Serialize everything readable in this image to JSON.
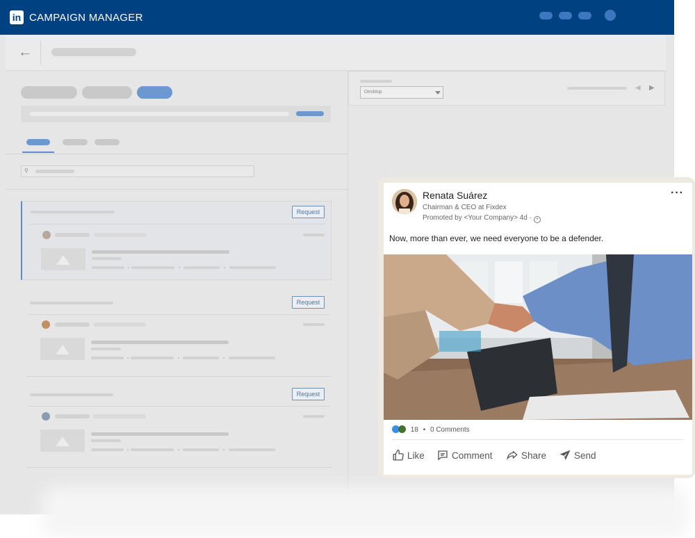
{
  "app": {
    "logo_text": "in",
    "title": "CAMPAIGN MANAGER"
  },
  "preview": {
    "device_select": "Desktop"
  },
  "request_buttons": [
    "Request",
    "Request",
    "Request"
  ],
  "post": {
    "author_name": "Renata Suárez",
    "author_title": "Chairman & CEO at Fixdex",
    "promoted_by": "Promoted by <Your Company> 4d ·",
    "more_icon": "more-horizontal-icon",
    "text": "Now, more than ever, we need everyone to be a defender.",
    "reactions_count": "18",
    "comments": "0 Comments",
    "actions": {
      "like": "Like",
      "comment": "Comment",
      "share": "Share",
      "send": "Send"
    }
  },
  "colors": {
    "topbar": "#004182",
    "accent": "#0a66c2",
    "app_bg": "#e6e6e6"
  }
}
